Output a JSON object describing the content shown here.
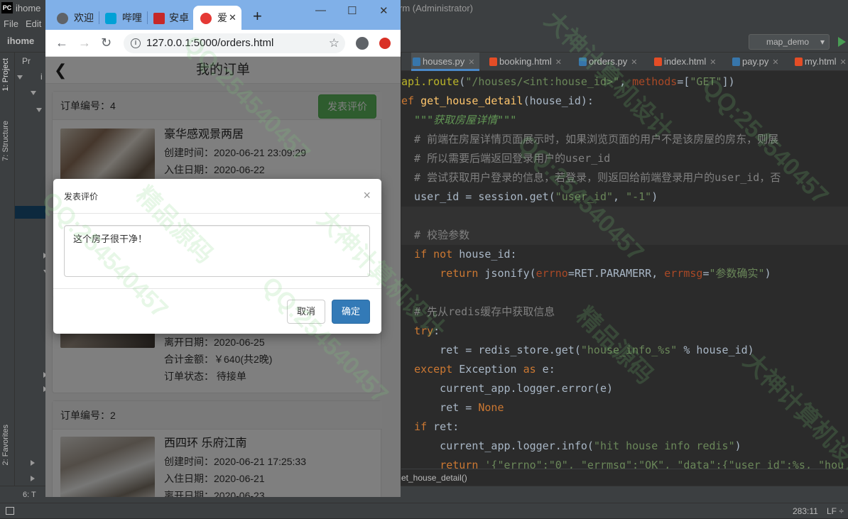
{
  "ide": {
    "title_left": "ihome",
    "title_right": "rm (Administrator)",
    "menu": [
      "File",
      "Edit"
    ],
    "project_name": "ihome",
    "run_config": "map_demo",
    "left_tabs": [
      "1: Project",
      "7: Structure",
      "2: Favorites"
    ],
    "tree_label": "Pr",
    "tree_letter": "i",
    "file_tabs": [
      {
        "label": "houses.py",
        "active": true
      },
      {
        "label": "booking.html",
        "active": false
      },
      {
        "label": "orders.py",
        "active": false
      },
      {
        "label": "index.html",
        "active": false
      },
      {
        "label": "pay.py",
        "active": false
      },
      {
        "label": "my.html",
        "active": false
      }
    ],
    "breadcrumb": "et_house_detail()",
    "bottom_tab": "6: T",
    "status_position": "283:11",
    "status_line_ending": "LF ÷",
    "code_lines": [
      "api.route(\"/houses/<int:house_id>\", methods=[\"GET\"])",
      "ef get_house_detail(house_id):",
      "  \"\"\"获取房屋详情\"\"\"",
      "  # 前端在房屋详情页面展示时，如果浏览页面的用户不是该房屋的房东，则展",
      "  # 所以需要后端返回登录用户的user_id",
      "  # 尝试获取用户登录的信息，若登录，则返回给前端登录用户的user_id，否",
      "  user_id = session.get(\"user_id\", \"-1\")",
      "",
      "  # 校验参数",
      "  if not house_id:",
      "      return jsonify(errno=RET.PARAMERR, errmsg=\"参数确实\")",
      "",
      "  # 先从redis缓存中获取信息",
      "  try:",
      "      ret = redis_store.get(\"house_info_%s\" % house_id)",
      "  except Exception as e:",
      "      current_app.logger.error(e)",
      "      ret = None",
      "  if ret:",
      "      current_app.logger.info(\"hit house info redis\")",
      "      return '{\"errno\":\"0\", \"errmsg\":\"OK\", \"data\":{\"user_id\":%s, \"hou"
    ]
  },
  "browser": {
    "tabs": [
      {
        "label": "欢迎",
        "active": false
      },
      {
        "label": "哔哩",
        "active": false
      },
      {
        "label": "安卓",
        "active": false
      },
      {
        "label": "爱",
        "active": true
      }
    ],
    "url": "127.0.0.1:5000/orders.html",
    "new_tab": "+",
    "minimize": "—",
    "maximize": "☐",
    "close": "✕"
  },
  "page": {
    "title": "我的订单",
    "orders": [
      {
        "id_label": "订单编号：4",
        "button": "发表评价",
        "name": "豪华感观景两居",
        "created": "创建时间：2020-06-21 23:09:29",
        "checkin": "入住日期：2020-06-22"
      },
      {
        "checkout": "离开日期：2020-06-25",
        "total": "合计金额：￥640(共2晚)",
        "status": "订单状态： 待接单"
      },
      {
        "id_label": "订单编号：2",
        "name": "西四环 乐府江南",
        "created": "创建时间：2020-06-21 17:25:33",
        "checkin": "入住日期：2020-06-21",
        "checkout": "离开日期：2020-06-23"
      }
    ]
  },
  "modal": {
    "title": "发表评价",
    "close": "×",
    "comment": "这个房子很干净！",
    "cancel": "取消",
    "confirm": "确定"
  },
  "watermark": [
    "QQ:254540457",
    "精品源码",
    "大神计算机设计"
  ],
  "colors": {
    "ide_bg": "#2b2b2b",
    "keyword": "#cc7832",
    "string": "#6a8759",
    "comment": "#808080",
    "success_button": "#5cb85c",
    "primary_button": "#337ab7",
    "chrome_tabbar": "#80b0e8"
  }
}
